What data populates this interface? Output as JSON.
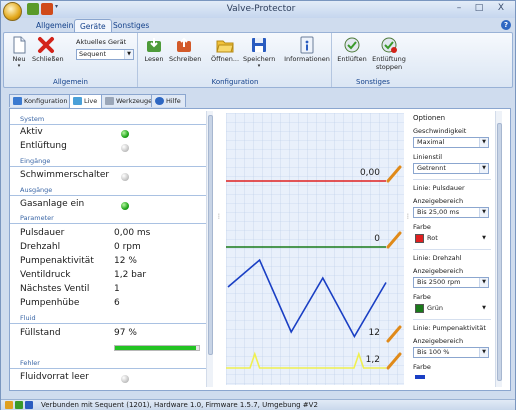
{
  "window": {
    "title": "Valve-Protector",
    "controls": {
      "minimize": "–",
      "maximize": "□",
      "close": "X"
    },
    "help_glyph": "?"
  },
  "ribbon_tabs": [
    "Allgemein",
    "Geräte",
    "Sonstiges"
  ],
  "ribbon": {
    "allgemein": {
      "label": "Allgemein",
      "new": "Neu",
      "close": "Schließen",
      "device_label": "Aktuelles Gerät",
      "device_value": "Sequent"
    },
    "konfiguration": {
      "label": "Konfiguration",
      "read": "Lesen",
      "write": "Schreiben",
      "open": "Öffnen...",
      "save": "Speichern",
      "info": "Informationen"
    },
    "sonstiges": {
      "label": "Sonstiges",
      "bleed": "Entlüften",
      "bleed_stop_1": "Entlüftung",
      "bleed_stop_2": "stoppen"
    }
  },
  "doc_tabs": [
    "Konfiguration",
    "Live",
    "Werkzeuge",
    "Hilfe"
  ],
  "live": {
    "system": {
      "header": "System",
      "aktiv_label": "Aktiv",
      "aktiv_state": "on",
      "entl_label": "Entlüftung",
      "entl_state": "off"
    },
    "eingaenge": {
      "header": "Eingänge",
      "schwimmer_label": "Schwimmerschalter",
      "schwimmer_state": "off"
    },
    "ausgaenge": {
      "header": "Ausgänge",
      "gas_label": "Gasanlage ein",
      "gas_state": "on"
    },
    "parameter": {
      "header": "Parameter",
      "rows": [
        {
          "label": "Pulsdauer",
          "value": "0,00 ms"
        },
        {
          "label": "Drehzahl",
          "value": "0 rpm"
        },
        {
          "label": "Pumpenaktivität",
          "value": "12 %"
        },
        {
          "label": "Ventildruck",
          "value": "1,2 bar"
        },
        {
          "label": "Nächstes Ventil",
          "value": "1"
        },
        {
          "label": "Pumpenhübe",
          "value": "6"
        }
      ]
    },
    "fluid": {
      "header": "Fluid",
      "fuellstand_label": "Füllstand",
      "fuellstand_value": "97 %",
      "fuellstand_fraction": 0.97
    },
    "fehler": {
      "header": "Fehler",
      "leer_label": "Fluidvorrat leer",
      "leer_state": "off"
    }
  },
  "chart_data": {
    "type": "line",
    "traces": [
      {
        "name": "Pulsdauer",
        "color": "#e02020",
        "readout": "0,00",
        "y_fraction": [
          0,
          0,
          0,
          0,
          0,
          0
        ]
      },
      {
        "name": "Drehzahl",
        "color": "#1a7a1a",
        "readout": "0",
        "y_fraction": [
          0,
          0,
          0,
          0,
          0,
          0
        ]
      },
      {
        "name": "Pumpenaktivität",
        "color": "#1a3fc4",
        "readout": "12",
        "y_fraction": [
          0.6,
          0.9,
          0.1,
          0.7,
          0.05,
          0.65
        ]
      },
      {
        "name": "Ventildruck",
        "color": "#f0f050",
        "readout": "1,2"
      }
    ]
  },
  "options": {
    "header": "Optionen",
    "speed_label": "Geschwindigkeit",
    "speed_value": "Maximal",
    "line_style_label": "Linienstil",
    "line_style_value": "Getrennt",
    "lines": [
      {
        "title": "Linie: Pulsdauer",
        "range_label": "Anzeigebereich",
        "range_value": "Bis 25,00 ms",
        "color_label": "Farbe",
        "color_name": "Rot",
        "color_hex": "#e02020"
      },
      {
        "title": "Linie: Drehzahl",
        "range_label": "Anzeigebereich",
        "range_value": "Bis 2500 rpm",
        "color_label": "Farbe",
        "color_name": "Grün",
        "color_hex": "#1a7a1a"
      },
      {
        "title": "Linie: Pumpenaktivität",
        "range_label": "Anzeigebereich",
        "range_value": "Bis 100 %",
        "color_label": "Farbe"
      }
    ]
  },
  "status": {
    "text": "Verbunden mit Sequent (1201), Hardware 1.0, Firmware 1.5.7, Umgebung #V2"
  },
  "colors": {
    "accent": "#15428b",
    "led_on": "#1fa51a",
    "fill_bar": "#22c322"
  }
}
